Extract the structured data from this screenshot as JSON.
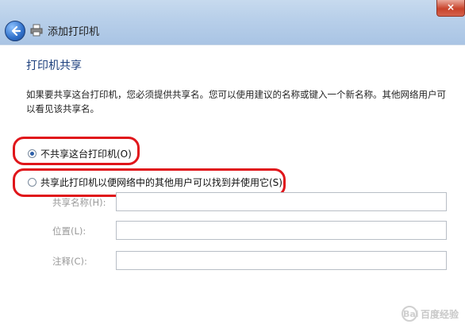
{
  "window": {
    "title": "添加打印机",
    "close_label": "×"
  },
  "page": {
    "heading": "打印机共享",
    "description": "如果要共享这台打印机，您必须提供共享名。您可以使用建议的名称或键入一个新名称。其他网络用户可以看见该共享名。"
  },
  "options": [
    {
      "label": "不共享这台打印机(O)",
      "checked": true
    },
    {
      "label": "共享此打印机以便网络中的其他用户可以找到并使用它(S)",
      "checked": false
    }
  ],
  "fields": [
    {
      "label": "共享名称(H):",
      "value": ""
    },
    {
      "label": "位置(L):",
      "value": ""
    },
    {
      "label": "注释(C):",
      "value": ""
    }
  ],
  "watermark": {
    "text": "百度经验",
    "mark": "Bai"
  },
  "colors": {
    "heading": "#1c3f7d",
    "highlight": "#e0161b"
  }
}
